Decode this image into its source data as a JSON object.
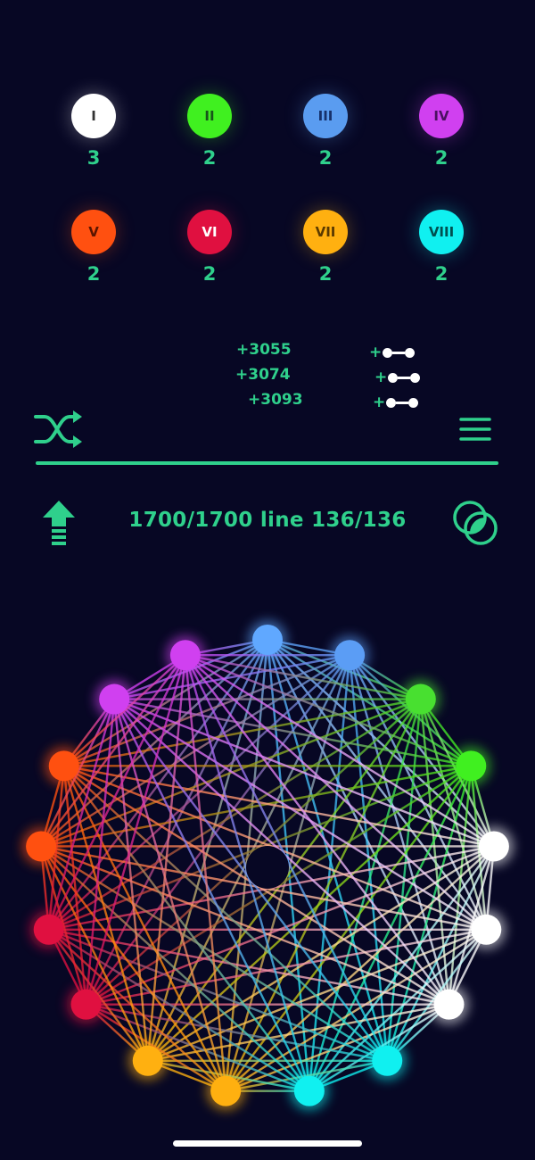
{
  "tiles": [
    {
      "label": "I",
      "count": "3",
      "color": "#ffffff",
      "text_color": "#333333"
    },
    {
      "label": "II",
      "count": "2",
      "color": "#40f020",
      "text_color": "#17551a"
    },
    {
      "label": "III",
      "count": "2",
      "color": "#5a9cf0",
      "text_color": "#16306a"
    },
    {
      "label": "IV",
      "count": "2",
      "color": "#d040f0",
      "text_color": "#4a1060"
    },
    {
      "label": "V",
      "count": "2",
      "color": "#ff5010",
      "text_color": "#5a1500"
    },
    {
      "label": "VI",
      "count": "2",
      "color": "#e01040",
      "text_color": "#ffffff"
    },
    {
      "label": "VII",
      "count": "2",
      "color": "#ffb010",
      "text_color": "#5a3a00"
    },
    {
      "label": "VIII",
      "count": "2",
      "color": "#10f0f0",
      "text_color": "#005050"
    }
  ],
  "scores": {
    "s1": "+3055",
    "s2": "+3074",
    "s3": "+3093",
    "plus": "+"
  },
  "status": {
    "text": "1700/1700 line 136/136"
  },
  "icons": {
    "shuffle": "shuffle-icon",
    "menu": "menu-icon",
    "upload": "arrow-up-icon",
    "overlap": "overlap-circles-icon"
  },
  "accent": "#2fd08c",
  "background": "#070724",
  "wheel_nodes": [
    "#60a8ff",
    "#5b9df5",
    "#48e030",
    "#40f020",
    "#ffffff",
    "#ffffff",
    "#ffffff",
    "#10f0f0",
    "#10f0f0",
    "#ffb010",
    "#ffb010",
    "#e01040",
    "#e01040",
    "#ff5010",
    "#ff5010",
    "#d040f0",
    "#d040f0"
  ]
}
